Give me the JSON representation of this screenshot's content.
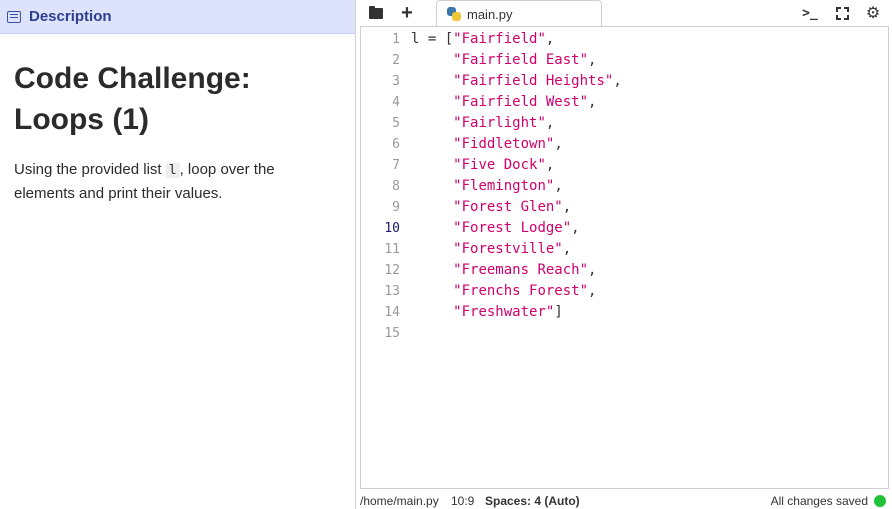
{
  "left_panel": {
    "tab_label": "Description",
    "title": "Code Challenge: Loops (1)",
    "text_before": "Using the provided list ",
    "code_word": "l",
    "text_after": ", loop over the elements and print their values."
  },
  "editor": {
    "file_tab": "main.py",
    "active_line": 10,
    "lines": [
      {
        "n": "1",
        "pre": "l = [",
        "str": "\"Fairfield\"",
        "post": ","
      },
      {
        "n": "2",
        "pre": "     ",
        "str": "\"Fairfield East\"",
        "post": ","
      },
      {
        "n": "3",
        "pre": "     ",
        "str": "\"Fairfield Heights\"",
        "post": ","
      },
      {
        "n": "4",
        "pre": "     ",
        "str": "\"Fairfield West\"",
        "post": ","
      },
      {
        "n": "5",
        "pre": "     ",
        "str": "\"Fairlight\"",
        "post": ","
      },
      {
        "n": "6",
        "pre": "     ",
        "str": "\"Fiddletown\"",
        "post": ","
      },
      {
        "n": "7",
        "pre": "     ",
        "str": "\"Five Dock\"",
        "post": ","
      },
      {
        "n": "8",
        "pre": "     ",
        "str": "\"Flemington\"",
        "post": ","
      },
      {
        "n": "9",
        "pre": "     ",
        "str": "\"Forest Glen\"",
        "post": ","
      },
      {
        "n": "10",
        "pre": "     ",
        "str": "\"Forest Lodge\"",
        "post": ","
      },
      {
        "n": "11",
        "pre": "     ",
        "str": "\"Forestville\"",
        "post": ","
      },
      {
        "n": "12",
        "pre": "     ",
        "str": "\"Freemans Reach\"",
        "post": ","
      },
      {
        "n": "13",
        "pre": "     ",
        "str": "\"Frenchs Forest\"",
        "post": ","
      },
      {
        "n": "14",
        "pre": "     ",
        "str": "\"Freshwater\"",
        "post": "]"
      },
      {
        "n": "15",
        "pre": "",
        "str": "",
        "post": ""
      }
    ]
  },
  "toolbar": {
    "icons": [
      "folder-icon",
      "plus-icon",
      "terminal-icon",
      "fullscreen-icon",
      "gear-icon"
    ],
    "terminal_glyph": ">_",
    "gear_glyph": "⚙",
    "plus_glyph": "+"
  },
  "status_bar": {
    "path": "/home/main.py",
    "position": "10:9",
    "spaces": "Spaces: 4 (Auto)",
    "saved": "All changes saved",
    "saved_color": "#22c13a"
  }
}
